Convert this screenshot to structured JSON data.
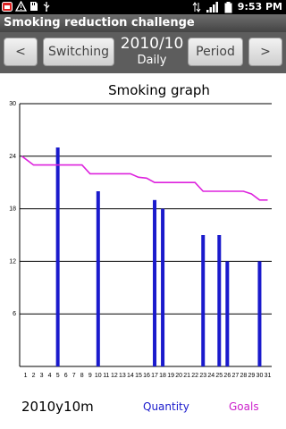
{
  "status_bar": {
    "time": "9:53 PM",
    "icons": [
      "calendar-notification-icon",
      "warning-icon",
      "sd-card-icon",
      "usb-icon",
      "data-arrows-icon",
      "signal-icon",
      "battery-icon"
    ]
  },
  "app": {
    "title": "Smoking reduction challenge"
  },
  "toolbar": {
    "prev_label": "<",
    "switching_label": "Switching",
    "month_label": "2010/10",
    "mode_label": "Daily",
    "period_label": "Period",
    "next_label": ">"
  },
  "chart_data": {
    "type": "bar",
    "title": "Smoking graph",
    "ylim": [
      0,
      30
    ],
    "y_ticks": [
      6,
      12,
      18,
      24,
      30
    ],
    "grid": true,
    "categories": [
      "1",
      "2",
      "3",
      "4",
      "5",
      "6",
      "7",
      "8",
      "9",
      "10",
      "11",
      "12",
      "13",
      "14",
      "15",
      "16",
      "17",
      "18",
      "19",
      "20",
      "21",
      "22",
      "23",
      "24",
      "25",
      "26",
      "27",
      "28",
      "29",
      "30",
      "31"
    ],
    "series": [
      {
        "name": "Quantity",
        "type": "bar",
        "color": "#1a1acc",
        "values": [
          0,
          0,
          0,
          0,
          25,
          0,
          0,
          0,
          0,
          20,
          0,
          0,
          0,
          0,
          0,
          0,
          19,
          18,
          0,
          0,
          0,
          0,
          15,
          0,
          15,
          12,
          0,
          0,
          0,
          12,
          0
        ]
      },
      {
        "name": "Goals",
        "type": "line",
        "color": "#dd22dd",
        "values": [
          24,
          23,
          23,
          23,
          23,
          23,
          23,
          23,
          22,
          22,
          22,
          22,
          22,
          22,
          21.6,
          21.5,
          21,
          21,
          21,
          21,
          21,
          21,
          20,
          20,
          20,
          20,
          20,
          20,
          19.7,
          19,
          19
        ]
      }
    ]
  },
  "footer": {
    "month": "2010y10m",
    "quantity_label": "Quantity",
    "goals_label": "Goals"
  }
}
